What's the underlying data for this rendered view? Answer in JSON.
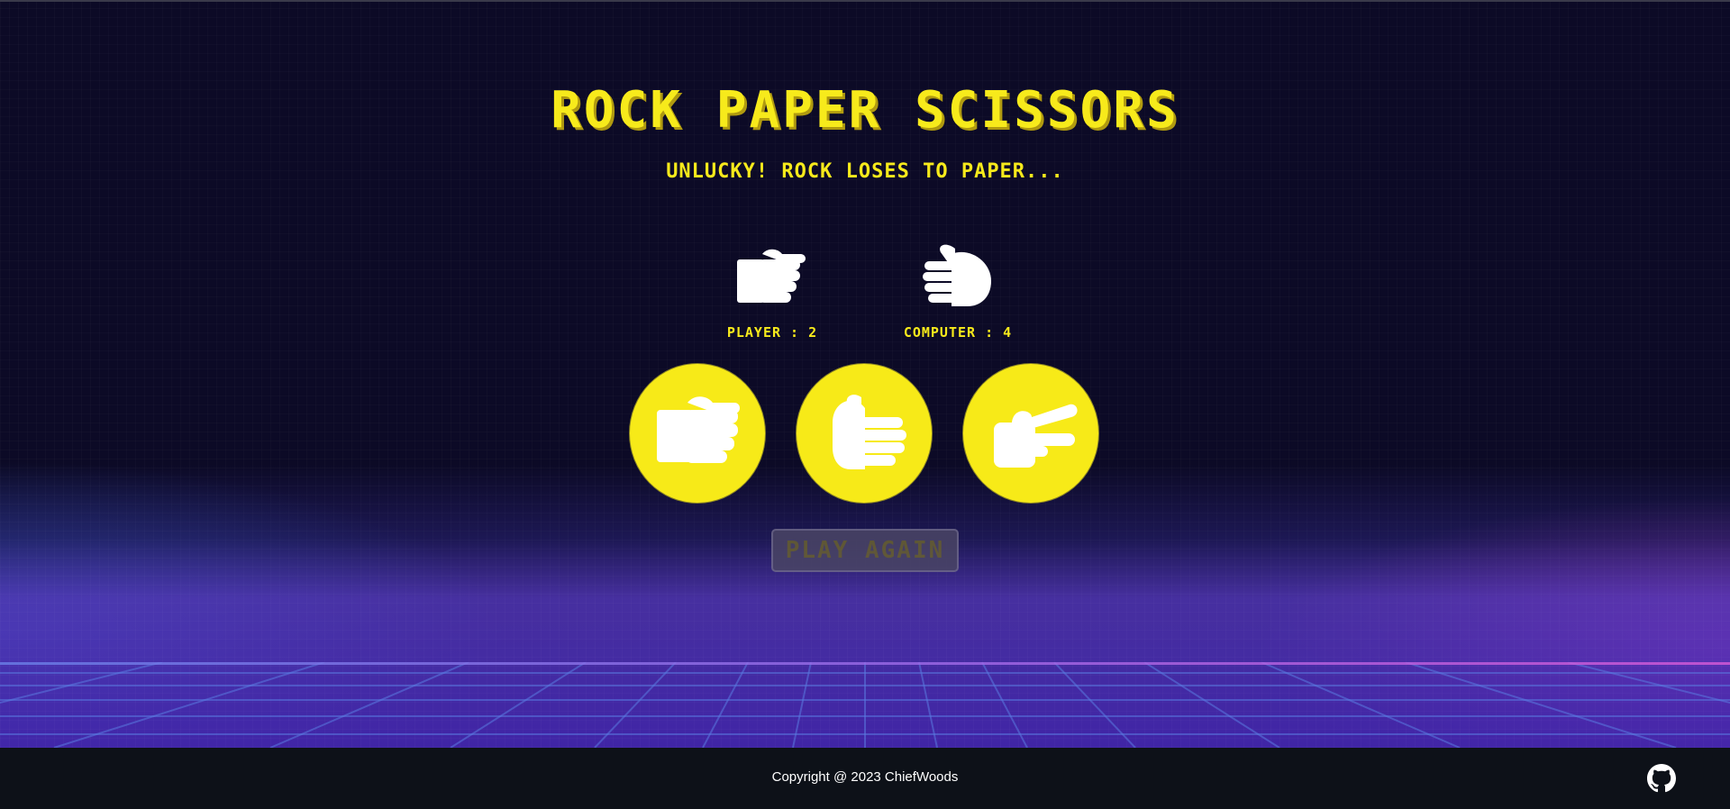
{
  "title": "Rock Paper Scissors",
  "result_message": "Unlucky! Rock loses to Paper...",
  "player": {
    "choice_icon": "rock-hand-icon",
    "score_label": "Player : 2"
  },
  "computer": {
    "choice_icon": "paper-hand-icon",
    "score_label": "Computer : 4"
  },
  "choices": [
    {
      "name": "rock",
      "icon": "rock-hand-icon"
    },
    {
      "name": "paper",
      "icon": "paper-hand-icon"
    },
    {
      "name": "scissors",
      "icon": "scissors-hand-icon"
    }
  ],
  "play_again_label": "Play Again",
  "footer": {
    "copyright": "Copyright @ 2023 ChiefWoods",
    "github_icon": "github-icon"
  },
  "colors": {
    "accent": "#f7ea1b",
    "background": "#0c0a26",
    "footer": "#0d1118"
  }
}
